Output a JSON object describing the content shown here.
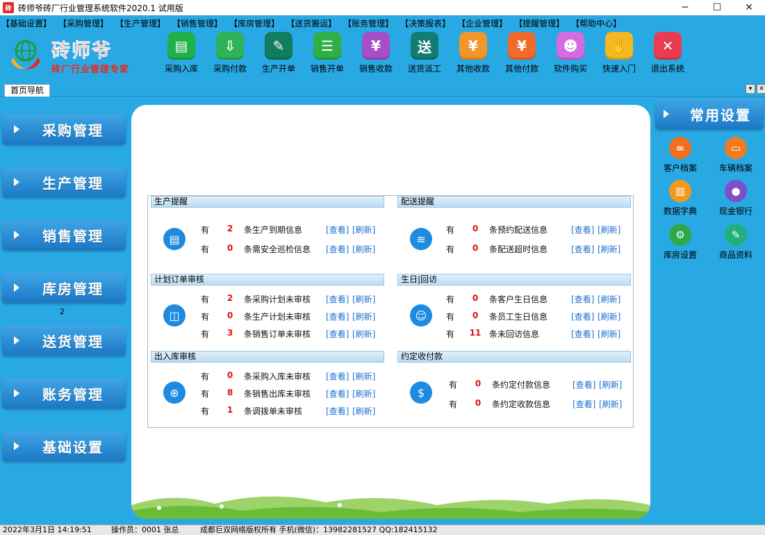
{
  "window": {
    "title": "砖师爷砖厂行业管理系统软件2020.1 试用版",
    "app_icon_text": "砖",
    "min": "─",
    "max": "☐",
    "close": "✕"
  },
  "menu": [
    "【基础设置】",
    "【采购管理】",
    "【生产管理】",
    "【销售管理】",
    "【库房管理】",
    "【送货搬运】",
    "【账务管理】",
    "【决策报表】",
    "【企业管理】",
    "【提醒管理】",
    "【帮助中心】"
  ],
  "logo": {
    "title": "砖师爷",
    "subtitle": "砖厂行业管理专家"
  },
  "toolbar": [
    {
      "label": "采购入库",
      "icon": "folder-icon",
      "glyph": "▤",
      "color": "#1fb04a"
    },
    {
      "label": "采购付款",
      "icon": "download-icon",
      "glyph": "⇩",
      "color": "#2fb35a"
    },
    {
      "label": "生产开单",
      "icon": "document-icon",
      "glyph": "✎",
      "color": "#127c5e"
    },
    {
      "label": "销售开单",
      "icon": "form-icon",
      "glyph": "☰",
      "color": "#2fb047"
    },
    {
      "label": "销售收款",
      "icon": "invoice-icon",
      "glyph": "¥",
      "color": "#a64fc8"
    },
    {
      "label": "送货派工",
      "icon": "truck-icon",
      "glyph": "送",
      "color": "#127c74"
    },
    {
      "label": "其他收款",
      "icon": "money-bag-icon",
      "glyph": "¥",
      "color": "#f2962a"
    },
    {
      "label": "其他付款",
      "icon": "payment-icon",
      "glyph": "¥",
      "color": "#ef6a2b"
    },
    {
      "label": "软件购买",
      "icon": "users-icon",
      "glyph": "☻",
      "color": "#d36ce0"
    },
    {
      "label": "快速入门",
      "icon": "hand-icon",
      "glyph": "✋",
      "color": "#f5b820"
    },
    {
      "label": "退出系统",
      "icon": "exit-icon",
      "glyph": "✕",
      "color": "#ea3b50"
    }
  ],
  "tabs": {
    "home": "首页导航",
    "dropdown": "▾",
    "close": "✕"
  },
  "nav": [
    "采购管理",
    "生产管理",
    "销售管理",
    "库房管理",
    "送货管理",
    "账务管理",
    "基础设置"
  ],
  "nav_note": "2",
  "sections": {
    "production": {
      "title": "生产提醒",
      "rows": [
        {
          "you": "有",
          "num": "2",
          "text": "条生产到期信息",
          "view": "[查看]",
          "refresh": "[刷新]"
        },
        {
          "you": "有",
          "num": "0",
          "text": "条需安全巡检信息",
          "view": "[查看]",
          "refresh": "[刷新]"
        }
      ]
    },
    "delivery": {
      "title": "配送提醒",
      "rows": [
        {
          "you": "有",
          "num": "0",
          "text": "条预约配送信息",
          "view": "[查看]",
          "refresh": "[刷新]"
        },
        {
          "you": "有",
          "num": "0",
          "text": "条配送超时信息",
          "view": "[查看]",
          "refresh": "[刷新]"
        }
      ]
    },
    "plan_audit": {
      "title": "计划订单审核",
      "rows": [
        {
          "you": "有",
          "num": "2",
          "text": "条采购计划未审核",
          "view": "[查看]",
          "refresh": "[刷新]"
        },
        {
          "you": "有",
          "num": "0",
          "text": "条生产计划未审核",
          "view": "[查看]",
          "refresh": "[刷新]"
        },
        {
          "you": "有",
          "num": "3",
          "text": "条销售订单未审核",
          "view": "[查看]",
          "refresh": "[刷新]"
        }
      ]
    },
    "birthday": {
      "title": "生日|回访",
      "rows": [
        {
          "you": "有",
          "num": "0",
          "text": "条客户生日信息",
          "view": "[查看]",
          "refresh": "[刷新]"
        },
        {
          "you": "有",
          "num": "0",
          "text": "条员工生日信息",
          "view": "[查看]",
          "refresh": "[刷新]"
        },
        {
          "you": "有",
          "num": "11",
          "text": "条未回访信息",
          "view": "[查看]",
          "refresh": "[刷新]"
        }
      ]
    },
    "stock_audit": {
      "title": "出入库审核",
      "rows": [
        {
          "you": "有",
          "num": "0",
          "text": "条采购入库未审核",
          "view": "[查看]",
          "refresh": "[刷新]"
        },
        {
          "you": "有",
          "num": "8",
          "text": "条销售出库未审核",
          "view": "[查看]",
          "refresh": "[刷新]"
        },
        {
          "you": "有",
          "num": "1",
          "text": "条调拨单未审核",
          "view": "[查看]",
          "refresh": "[刷新]"
        }
      ]
    },
    "payment": {
      "title": "约定收付款",
      "rows": [
        {
          "you": "有",
          "num": "0",
          "text": "条约定付款信息",
          "view": "[查看]",
          "refresh": "[刷新]"
        },
        {
          "you": "有",
          "num": "0",
          "text": "条约定收款信息",
          "view": "[查看]",
          "refresh": "[刷新]"
        }
      ]
    }
  },
  "settings": {
    "title": "常用设置",
    "items": [
      {
        "label": "客户档案",
        "icon": "link-icon",
        "glyph": "∞",
        "color": "#f0701e"
      },
      {
        "label": "车辆档案",
        "icon": "monitor-icon",
        "glyph": "▭",
        "color": "#ef7a1f"
      },
      {
        "label": "数据字典",
        "icon": "book-icon",
        "glyph": "▥",
        "color": "#f39a1a"
      },
      {
        "label": "现金银行",
        "icon": "coin-icon",
        "glyph": "●",
        "color": "#7a4fc8"
      },
      {
        "label": "库房设置",
        "icon": "gear-icon",
        "glyph": "⚙",
        "color": "#2fa84b"
      },
      {
        "label": "商品资料",
        "icon": "pencil-icon",
        "glyph": "✎",
        "color": "#22b07a"
      }
    ]
  },
  "status": {
    "datetime": "2022年3月1日 14:19:51",
    "operator": "操作员：0001 张总",
    "copyright": "成都巨双网络版权所有 手机(微信)：13982281527 QQ:182415132"
  }
}
